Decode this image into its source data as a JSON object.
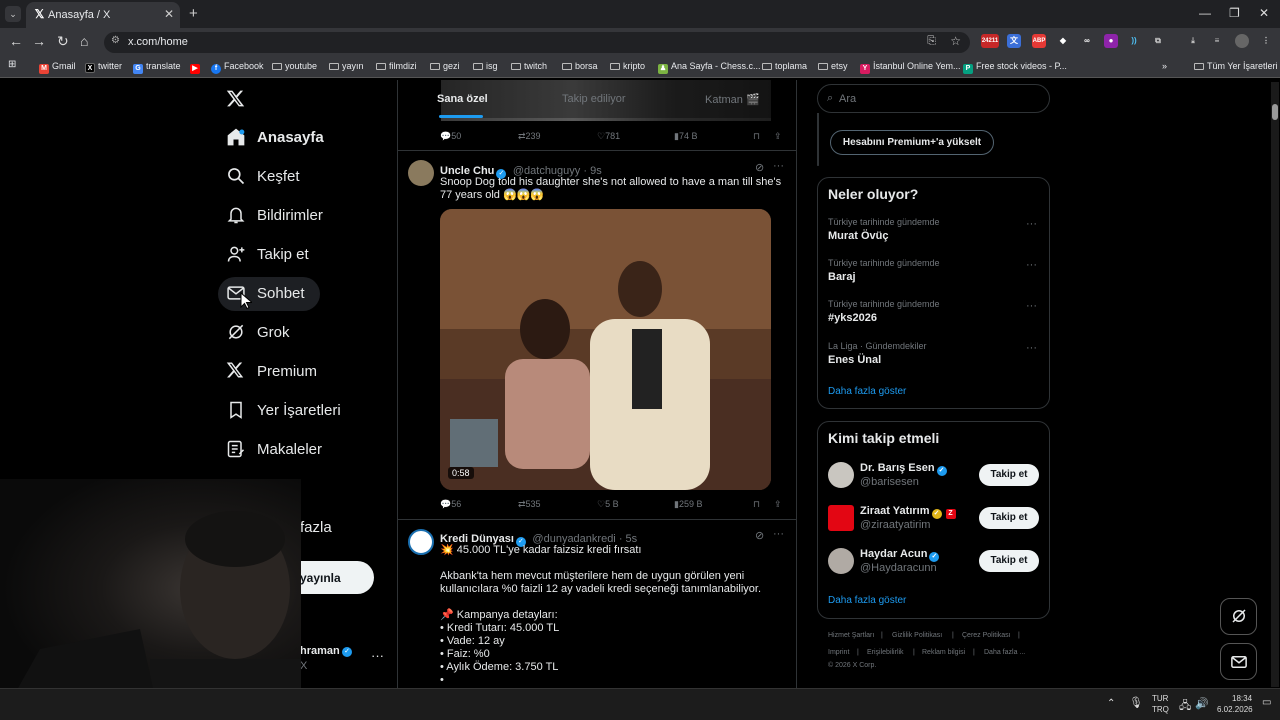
{
  "browser": {
    "tab_title": "Anasayfa / X",
    "url": "x.com/home",
    "bookmarks": [
      "Gmail",
      "twitter",
      "translate",
      "Facebook",
      "youtube",
      "yayın",
      "filmdizi",
      "gezi",
      "isg",
      "twitch",
      "borsa",
      "kripto",
      "Ana Sayfa - Chess.c...",
      "toplama",
      "etsy",
      "İstanbul Online Yem...",
      "Free stock videos - P..."
    ],
    "all_bookmarks": "Tüm Yer İşaretleri",
    "ext_badge": "24211"
  },
  "sidebar": {
    "items": [
      {
        "label": "Anasayfa",
        "icon": "home-icon"
      },
      {
        "label": "Keşfet",
        "icon": "search-icon"
      },
      {
        "label": "Bildirimler",
        "icon": "bell-icon"
      },
      {
        "label": "Takip et",
        "icon": "person-add-icon"
      },
      {
        "label": "Sohbet",
        "icon": "mail-icon"
      },
      {
        "label": "Grok",
        "icon": "grok-icon"
      },
      {
        "label": "Premium",
        "icon": "x-logo-icon"
      },
      {
        "label": "Yer İşaretleri",
        "icon": "bookmark-icon"
      },
      {
        "label": "Makaleler",
        "icon": "article-icon"
      }
    ],
    "more_partial": "fazla",
    "post_partial": "yayınla",
    "profile_name_partial": "hraman",
    "profile_handle_partial": "X"
  },
  "feed": {
    "tabs": [
      "Sana özel",
      "Takip ediliyor",
      "Katman 🎬"
    ],
    "prev_actions": {
      "replies": "50",
      "reposts": "239",
      "likes": "781",
      "views": "74 B"
    },
    "tweets": [
      {
        "name": "Uncle Chu",
        "handle": "@datchuguyy",
        "time": "9s",
        "text": "Snoop Dog told his daughter she's not allowed to have a man till she's 77 years old 😱😱😱",
        "video_duration": "0:58",
        "replies": "56",
        "reposts": "535",
        "likes": "5 B",
        "views": "259 B"
      },
      {
        "name": "Kredi Dünyası",
        "handle": "@dunyadankredi",
        "time": "5s",
        "lines": [
          "💥 45.000 TL'ye kadar faizsiz kredi fırsatı",
          "",
          "Akbank'ta hem mevcut müşterilere hem de uygun görülen yeni kullanıcılara %0 faizli 12 ay vadeli kredi seçeneği tanımlanabiliyor.",
          "",
          "📌 Kampanya detayları:",
          "• Kredi Tutarı: 45.000 TL",
          "• Vade: 12 ay",
          "• Faiz: %0",
          "• Aylık Ödeme: 3.750 TL",
          "•"
        ]
      }
    ]
  },
  "right": {
    "search_placeholder": "Ara",
    "premium_button": "Hesabını Premium+'a yükselt",
    "trends_title": "Neler oluyor?",
    "trends": [
      {
        "context": "Türkiye tarihinde gündemde",
        "name": "Murat Övüç"
      },
      {
        "context": "Türkiye tarihinde gündemde",
        "name": "Baraj"
      },
      {
        "context": "Türkiye tarihinde gündemde",
        "name": "#yks2026"
      },
      {
        "context": "La Liga · Gündemdekiler",
        "name": "Enes Ünal"
      }
    ],
    "show_more": "Daha fazla göster",
    "who_title": "Kimi takip etmeli",
    "suggestions": [
      {
        "name": "Dr. Barış Esen",
        "handle": "@barisesen",
        "button": "Takip et"
      },
      {
        "name": "Ziraat Yatırım",
        "handle": "@ziraatyatirim",
        "button": "Takip et"
      },
      {
        "name": "Haydar Acun",
        "handle": "@Haydaracunn",
        "button": "Takip et"
      }
    ],
    "footer": [
      "Hizmet Şartları",
      "Gizlilik Politikası",
      "Çerez Politikası",
      "Imprint",
      "Erişilebilirlik",
      "Reklam bilgisi",
      "Daha fazla ...",
      "© 2026 X Corp."
    ]
  },
  "taskbar": {
    "lang1": "TUR",
    "lang2": "TRQ",
    "time": "18:34",
    "date": "6.02.2026"
  },
  "colors": {
    "accent": "#1d9bf0",
    "bg": "#000000",
    "border": "#2f3336",
    "muted": "#71767b"
  }
}
